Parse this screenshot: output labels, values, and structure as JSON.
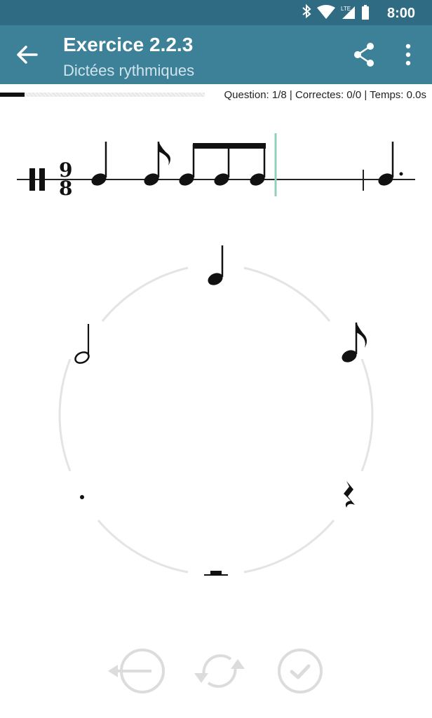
{
  "status_bar": {
    "time": "8:00",
    "icons": [
      "bluetooth-icon",
      "wifi-icon",
      "lte-signal-icon",
      "battery-icon"
    ],
    "network_label": "LTE"
  },
  "app_bar": {
    "title": "Exercice 2.2.3",
    "subtitle": "Dictées rythmiques",
    "icons": [
      "back-arrow-icon",
      "share-icon",
      "more-vert-icon"
    ]
  },
  "progress": {
    "fraction": 0.12,
    "text": "Question: 1/8 | Correctes: 0/0 | Temps: 0.0s"
  },
  "staff": {
    "time_signature": {
      "top": "9",
      "bottom": "8"
    },
    "notes": [
      "quarter",
      "eighth",
      "eighth",
      "eighth",
      "eighth"
    ],
    "answer_notes": [
      "dotted-quarter"
    ]
  },
  "wheel": {
    "options": [
      "quarter-note",
      "eighth-note",
      "quarter-rest",
      "whole-rest",
      "dot",
      "half-note"
    ]
  },
  "controls": [
    "backspace-icon",
    "replay-icon",
    "check-icon"
  ],
  "colors": {
    "status_bar": "#2f6b82",
    "app_bar": "#3d8199",
    "cursor": "#8fd0b6",
    "disabled": "#dcdcdc"
  }
}
